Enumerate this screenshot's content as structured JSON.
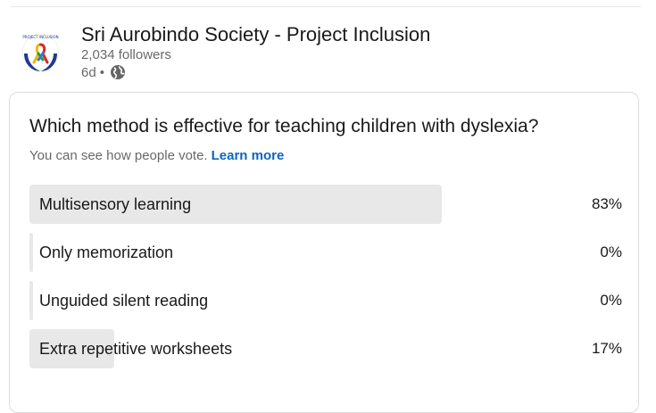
{
  "author": {
    "name": "Sri Aurobindo Society - Project Inclusion",
    "followers": "2,034 followers",
    "age": "6d",
    "separator": "•",
    "visibility_icon": "globe-icon",
    "logo_text": "PROJECT INCLUSION"
  },
  "poll": {
    "question": "Which method is effective for teaching children with dyslexia?",
    "note": "You can see how people vote.",
    "learn_more": "Learn more",
    "options": [
      {
        "label": "Multisensory learning",
        "percent_text": "83%",
        "percent": 83
      },
      {
        "label": "Only memorization",
        "percent_text": "0%",
        "percent": 0
      },
      {
        "label": "Unguided silent reading",
        "percent_text": "0%",
        "percent": 0
      },
      {
        "label": "Extra repetitive worksheets",
        "percent_text": "17%",
        "percent": 17
      }
    ]
  },
  "colors": {
    "link": "#0a66c2",
    "bar": "#e8e8e8",
    "logo_blue": "#1f3b8f",
    "ribbon_yellow": "#f2b705",
    "ribbon_red": "#d7262b",
    "ribbon_green": "#2e9a45",
    "ribbon_blue": "#2a7fd4"
  }
}
